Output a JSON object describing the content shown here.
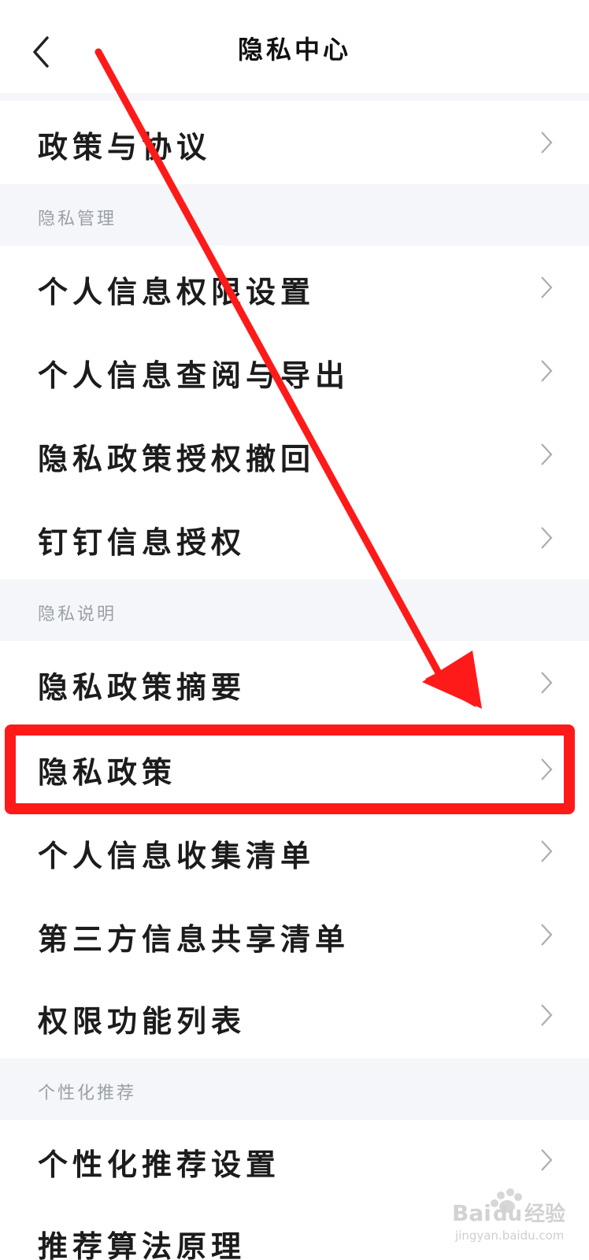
{
  "header": {
    "title": "隐私中心",
    "back_icon": "chevron-left-icon"
  },
  "rows": {
    "policy_agreement": "政策与协议",
    "section_manage": "隐私管理",
    "personal_permissions": "个人信息权限设置",
    "personal_view_export": "个人信息查阅与导出",
    "privacy_revoke": "隐私政策授权撤回",
    "dingtalk_auth": "钉钉信息授权",
    "section_explain": "隐私说明",
    "privacy_summary": "隐私政策摘要",
    "privacy_policy": "隐私政策",
    "personal_collection": "个人信息收集清单",
    "third_party_share": "第三方信息共享清单",
    "permission_list": "权限功能列表",
    "section_recommend": "个性化推荐",
    "recommend_settings": "个性化推荐设置",
    "algorithm_principle": "推荐算法原理"
  },
  "annotation": {
    "highlight_color": "#ff1a1a",
    "arrow_color": "#ff1a1a"
  },
  "watermark": {
    "brand": "Bai",
    "brand2": "du",
    "cn": "经验",
    "url": "jingyan.baidu.com"
  }
}
